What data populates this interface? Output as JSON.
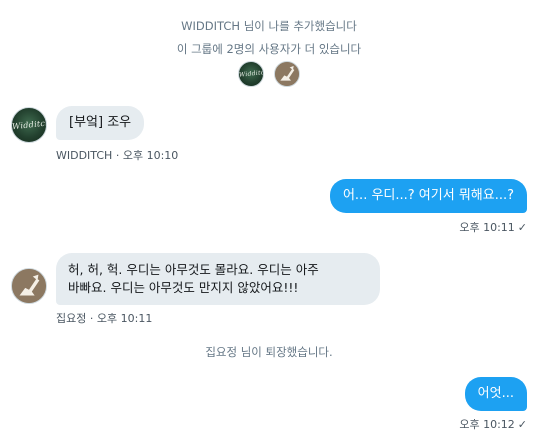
{
  "system": {
    "added": "WIDDITCH 님이 나를 추가했습니다",
    "others": "이 그룹에 2명의 사용자가 더 있습니다",
    "left": "집요정 님이 퇴장했습니다."
  },
  "avatar_logo_text": "Widditch",
  "messages": [
    {
      "sender": "WIDDITCH",
      "text": "[부엌] 조우",
      "time": "오후 10:10"
    },
    {
      "text": "어... 우디...? 여기서 뭐해요...?",
      "time": "오후 10:11",
      "check": "✓"
    },
    {
      "sender": "집요정",
      "text_line1": "허, 허, 헉. 우디는 아무것도 몰라요. 우디는 아주",
      "text_line2": "바빠요. 우디는 아무것도 만지지 않았어요!!!",
      "time": "오후 10:11"
    },
    {
      "text": "어엇...",
      "time": "오후 10:12",
      "check": "✓"
    }
  ],
  "colors": {
    "outgoing": "#1da1f2",
    "incoming": "#e6ecf0",
    "system_text": "#657786"
  }
}
